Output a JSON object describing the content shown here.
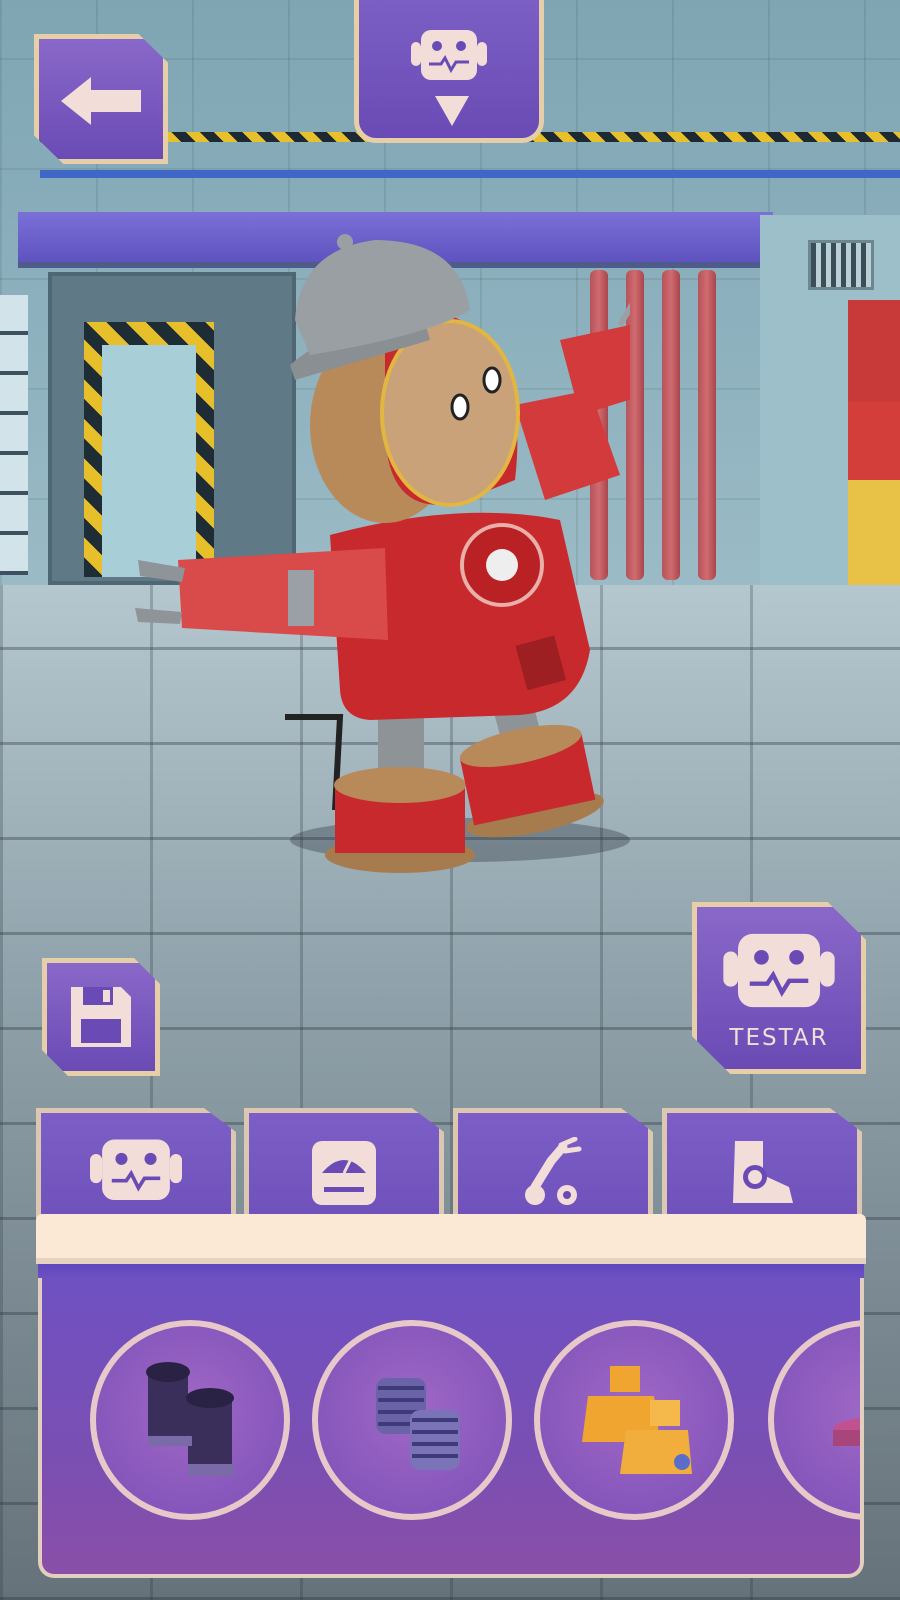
{
  "scene": {
    "name": "robot-workshop",
    "colors": {
      "ui_purple": "#6a4bb5",
      "ui_border": "#e6cfa8",
      "tab_strip": "#fbe9d6",
      "robot_red": "#c8292c",
      "hazard_yellow": "#e6bf2b"
    }
  },
  "top_bar": {
    "back_icon": "arrow-left-icon",
    "head_selector_icon": "robot-head-icon",
    "head_selector_indicator": "triangle-down-icon"
  },
  "side_buttons": {
    "save_icon": "floppy-disk-icon",
    "test_icon": "robot-head-icon",
    "test_label": "TESTAR"
  },
  "tabs": [
    {
      "id": "head",
      "icon": "robot-head-icon",
      "active": false
    },
    {
      "id": "body",
      "icon": "gauge-body-icon",
      "active": false
    },
    {
      "id": "arms",
      "icon": "robot-arm-icon",
      "active": false
    },
    {
      "id": "legs",
      "icon": "boot-icon",
      "active": true
    }
  ],
  "parts_panel": {
    "items": [
      {
        "id": "leg-dark-cylinders",
        "color": "#3a2f5a"
      },
      {
        "id": "leg-purple-springs",
        "color": "#6a63a8"
      },
      {
        "id": "leg-orange-blocks",
        "color": "#f0a531"
      },
      {
        "id": "leg-pink-pistons",
        "color": "#c0528f"
      }
    ]
  }
}
